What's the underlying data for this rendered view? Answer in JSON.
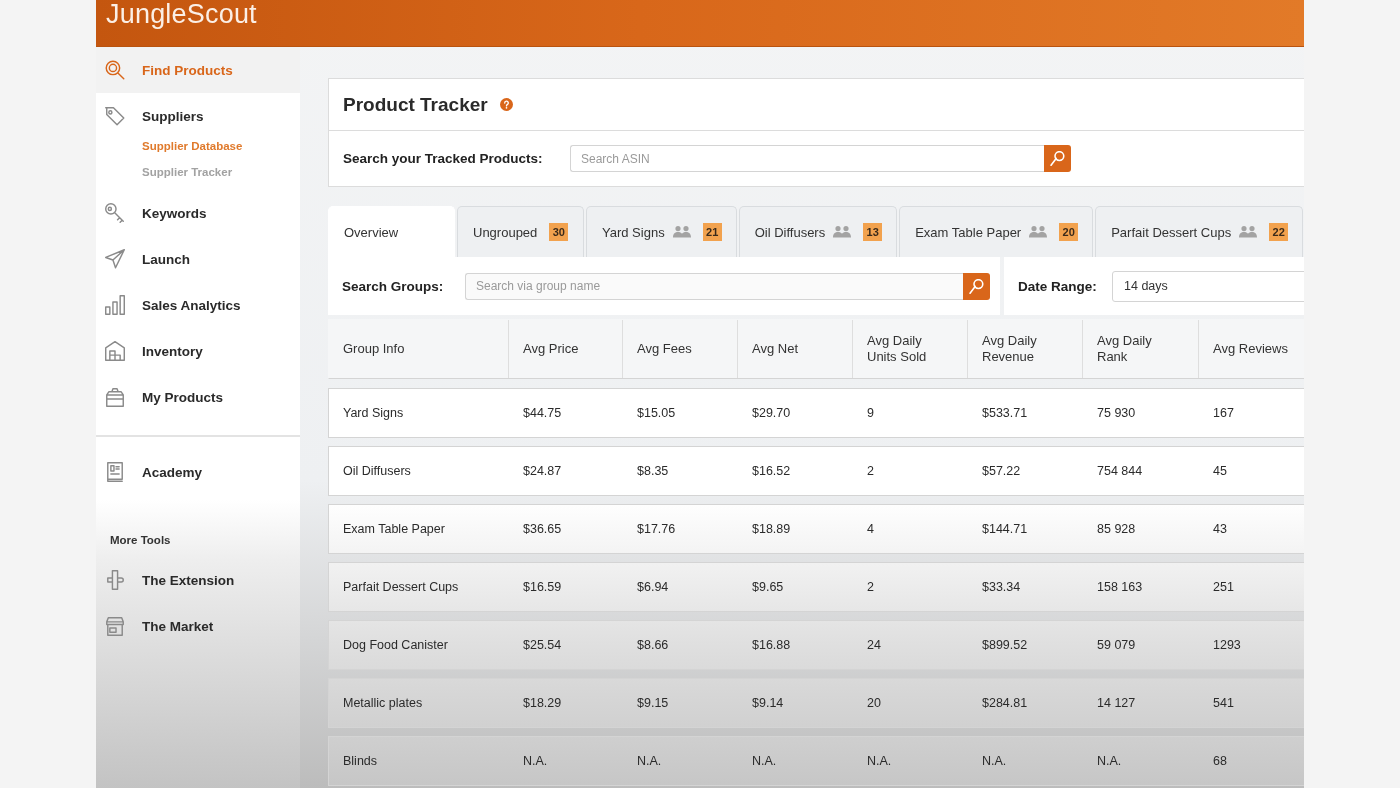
{
  "header": {
    "logo": "JungleScout"
  },
  "sidebar": {
    "groups": [
      {
        "items": [
          {
            "label": "Find Products",
            "selected": true
          },
          {
            "label": "Suppliers",
            "selected": false,
            "children": [
              {
                "label": "Supplier Database",
                "selected": true
              },
              {
                "label": "Supplier Tracker",
                "selected": false
              }
            ]
          },
          {
            "label": "Keywords",
            "selected": false
          },
          {
            "label": "Launch",
            "selected": false
          },
          {
            "label": "Sales Analytics",
            "selected": false
          },
          {
            "label": "Inventory",
            "selected": false
          },
          {
            "label": "My Products",
            "selected": false
          }
        ]
      },
      {
        "items": [
          {
            "label": "Academy",
            "selected": false
          }
        ]
      },
      {
        "heading": "More Tools",
        "items": [
          {
            "label": "The Extension",
            "selected": false
          },
          {
            "label": "The Market",
            "selected": false
          }
        ]
      }
    ]
  },
  "tracker": {
    "title": "Product Tracker",
    "search": {
      "label": "Search your Tracked Products:",
      "placeholder": "Search ASIN"
    }
  },
  "tabs": [
    {
      "label": "Overview",
      "selected": true,
      "shared": false
    },
    {
      "label": "Ungrouped",
      "selected": false,
      "shared": false,
      "count": "30"
    },
    {
      "label": "Yard Signs",
      "selected": false,
      "shared": true,
      "count": "21"
    },
    {
      "label": "Oil Diffusers",
      "selected": false,
      "shared": true,
      "count": "13"
    },
    {
      "label": "Exam Table Paper",
      "selected": false,
      "shared": true,
      "count": "20"
    },
    {
      "label": "Parfait Dessert Cups",
      "selected": false,
      "shared": true,
      "count": "22"
    }
  ],
  "group_search": {
    "label": "Search Groups:",
    "placeholder": "Search via group name"
  },
  "date_range": {
    "label": "Date Range:",
    "value": "14 days"
  },
  "table": {
    "columns": [
      "Group Info",
      "Avg Price",
      "Avg Fees",
      "Avg Net",
      "Avg Daily Units Sold",
      "Avg Daily Revenue",
      "Avg Daily Rank",
      "Avg Reviews"
    ],
    "rows": [
      [
        "Yard Signs",
        "$44.75",
        "$15.05",
        "$29.70",
        "9",
        "$533.71",
        "75 930",
        "167"
      ],
      [
        "Oil Diffusers",
        "$24.87",
        "$8.35",
        "$16.52",
        "2",
        "$57.22",
        "754 844",
        "45"
      ],
      [
        "Exam Table Paper",
        "$36.65",
        "$17.76",
        "$18.89",
        "4",
        "$144.71",
        "85 928",
        "43"
      ],
      [
        "Parfait Dessert Cups",
        "$16.59",
        "$6.94",
        "$9.65",
        "2",
        "$33.34",
        "158 163",
        "251"
      ],
      [
        "Dog Food Canister",
        "$25.54",
        "$8.66",
        "$16.88",
        "24",
        "$899.52",
        "59 079",
        "1293"
      ],
      [
        "Metallic plates",
        "$18.29",
        "$9.15",
        "$9.14",
        "20",
        "$284.81",
        "14 127",
        "541"
      ],
      [
        "Blinds",
        "N.A.",
        "N.A.",
        "N.A.",
        "N.A.",
        "N.A.",
        "N.A.",
        "68"
      ]
    ]
  }
}
